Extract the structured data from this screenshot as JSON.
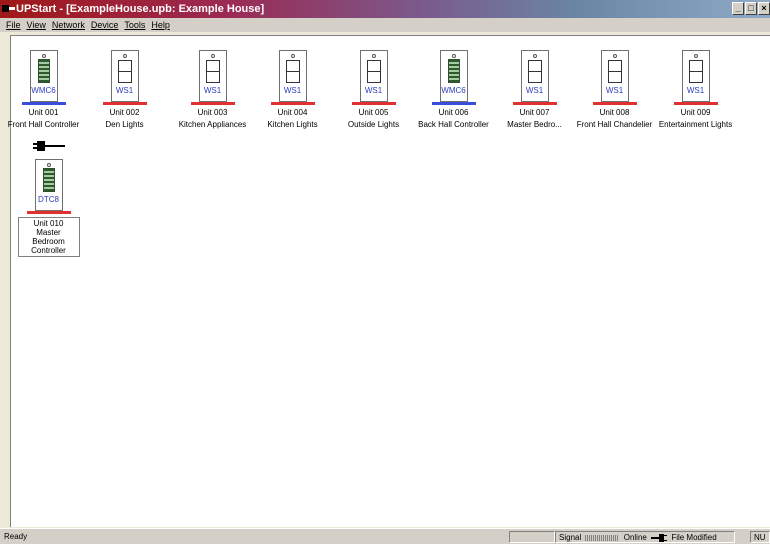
{
  "window": {
    "title": "UPStart - [ExampleHouse.upb: Example House]",
    "buttons": [
      "_",
      "□",
      "×"
    ]
  },
  "menu": [
    "File",
    "View",
    "Network",
    "Device",
    "Tools",
    "Help"
  ],
  "colors": {
    "accent_blue": "#3a4fd8",
    "accent_red": "#e03030",
    "label_blue": "#2a3dbb",
    "keypad_green": "#2e5a2e"
  },
  "devices": [
    {
      "type_label": "WMC6",
      "unit": "Unit 001",
      "name": "Front Hall Controller",
      "kind": "keypad",
      "underline_color": "#3a4fd8"
    },
    {
      "type_label": "WS1",
      "unit": "Unit 002",
      "name": "Den Lights",
      "kind": "switch",
      "underline_color": "#e03030"
    },
    {
      "type_label": "WS1",
      "unit": "Unit 003",
      "name": "Kitchen Appliances",
      "kind": "switch",
      "underline_color": "#e03030"
    },
    {
      "type_label": "WS1",
      "unit": "Unit 004",
      "name": "Kitchen Lights",
      "kind": "switch",
      "underline_color": "#e03030"
    },
    {
      "type_label": "WS1",
      "unit": "Unit 005",
      "name": "Outside Lights",
      "kind": "switch",
      "underline_color": "#e03030"
    },
    {
      "type_label": "WMC6",
      "unit": "Unit 006",
      "name": "Back Hall Controller",
      "kind": "keypad",
      "underline_color": "#3a4fd8"
    },
    {
      "type_label": "WS1",
      "unit": "Unit 007",
      "name": "Master Bedro...",
      "kind": "switch",
      "underline_color": "#e03030"
    },
    {
      "type_label": "WS1",
      "unit": "Unit 008",
      "name": "Front Hall Chandelier",
      "kind": "switch",
      "underline_color": "#e03030"
    },
    {
      "type_label": "WS1",
      "unit": "Unit 009",
      "name": "Entertainment Lights",
      "kind": "switch",
      "underline_color": "#e03030"
    }
  ],
  "selected_device": {
    "type_label": "DTC8",
    "unit": "Unit 010",
    "name": "Master Bedroom Controller",
    "kind": "keypad",
    "underline_color": "#e03030",
    "icon": "plug-icon"
  },
  "status": {
    "text": "Ready",
    "signal_label": "Signal",
    "online_label": "Online",
    "file_modified": "File Modified",
    "num": "NU"
  }
}
